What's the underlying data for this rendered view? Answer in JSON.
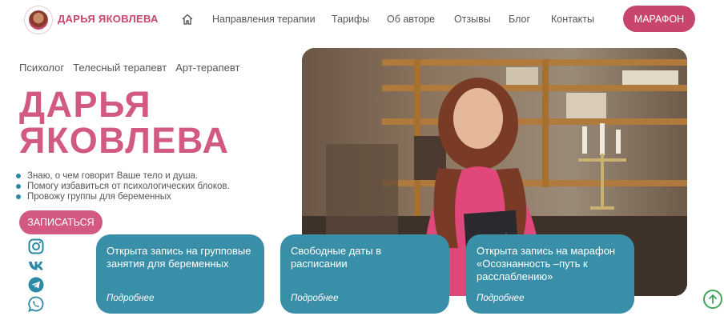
{
  "header": {
    "brand": "ДАРЬЯ ЯКОВЛЕВА",
    "nav": [
      "Направления терапии",
      "Тарифы",
      "Об авторе",
      "Отзывы",
      "Блог",
      "Контакты"
    ],
    "cta": "МАРАФОН"
  },
  "hero": {
    "roles": [
      "Психолог",
      "Телесный терапевт",
      "Арт-терапевт"
    ],
    "name_line1": "ДАРЬЯ",
    "name_line2": "ЯКОВЛЕВА",
    "bullets": [
      "Знаю, о чем говорит Ваше тело и душа.",
      "Помогу избавиться от психологических блоков.",
      "Провожу группы для беременных"
    ],
    "signup": "ЗАПИСАТЬСЯ"
  },
  "social": [
    "instagram-icon",
    "vk-icon",
    "telegram-icon",
    "whatsapp-icon"
  ],
  "cards": [
    {
      "title": "Открыта запись на групповые занятия для беременных",
      "more": "Подробнее"
    },
    {
      "title": "Свободные даты в расписании",
      "more": "Подробнее"
    },
    {
      "title": "Открыта запись на марафон «Осознанность –путь к расслаблению»",
      "more": "Подробнее"
    }
  ],
  "colors": {
    "accent": "#c8456b",
    "card": "#3a8fa8",
    "bullet": "#2a8aa5"
  }
}
